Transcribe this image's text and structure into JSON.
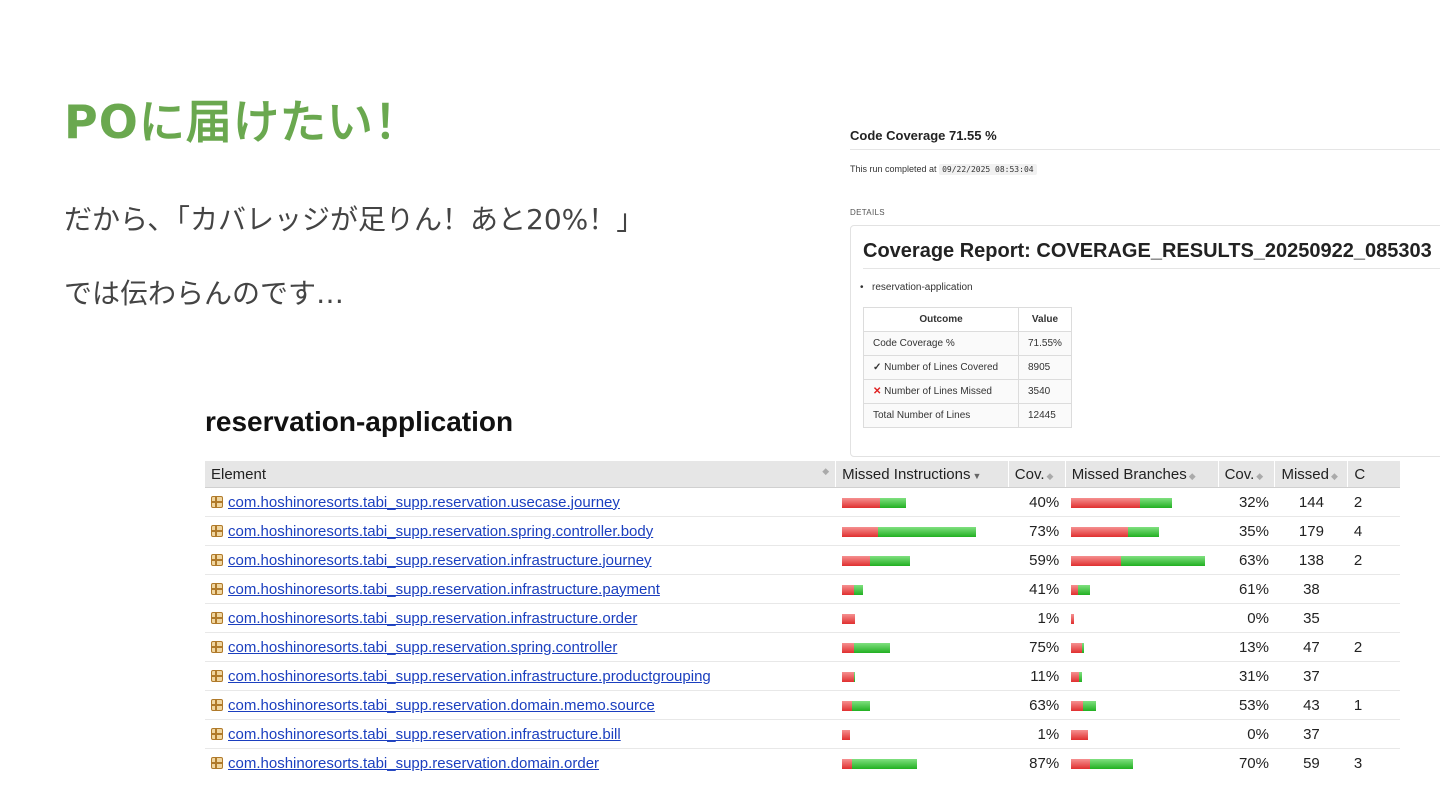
{
  "slide": {
    "title": "POに届けたい！",
    "line1": "だから､「カバレッジが足りん！あと20%！」",
    "line2": "では伝わらんのです…"
  },
  "coverage": {
    "title": "Code Coverage 71.55 %",
    "run_prefix": "This run completed at",
    "run_time": "09/22/2025 08:53:04",
    "details_label": "DETAILS",
    "report_title": "Coverage Report: COVERAGE_RESULTS_20250922_085303",
    "bullet": "reservation-application",
    "table_headers": [
      "Outcome",
      "Value"
    ],
    "rows": [
      {
        "icon": "",
        "label": "Code Coverage %",
        "value": "71.55%"
      },
      {
        "icon": "check-icon",
        "label": "Number of Lines Covered",
        "value": "8905"
      },
      {
        "icon": "cross-icon",
        "label": "Number of Lines Missed",
        "value": "3540"
      },
      {
        "icon": "",
        "label": "Total Number of Lines",
        "value": "12445"
      }
    ]
  },
  "report": {
    "title": "reservation-application",
    "headers": [
      "Element",
      "Missed Instructions",
      "Cov.",
      "Missed Branches",
      "Cov.",
      "Missed",
      "C"
    ],
    "colors": {
      "missed": "#e03030",
      "covered": "#22b022",
      "link": "#1b3fbf"
    },
    "rows": [
      {
        "element": "com.hoshinoresorts.tabi_supp.reservation.usecase.journey",
        "instr_total_rel": 0.48,
        "instr_cov": "40%",
        "instr_cov_frac": 0.4,
        "br_total_rel": 0.75,
        "br_cov": "32%",
        "br_cov_frac": 0.32,
        "missed": "144",
        "c": "2"
      },
      {
        "element": "com.hoshinoresorts.tabi_supp.reservation.spring.controller.body",
        "instr_total_rel": 1.0,
        "instr_cov": "73%",
        "instr_cov_frac": 0.73,
        "br_total_rel": 0.66,
        "br_cov": "35%",
        "br_cov_frac": 0.35,
        "missed": "179",
        "c": "4"
      },
      {
        "element": "com.hoshinoresorts.tabi_supp.reservation.infrastructure.journey",
        "instr_total_rel": 0.51,
        "instr_cov": "59%",
        "instr_cov_frac": 0.59,
        "br_total_rel": 1.0,
        "br_cov": "63%",
        "br_cov_frac": 0.63,
        "missed": "138",
        "c": "2"
      },
      {
        "element": "com.hoshinoresorts.tabi_supp.reservation.infrastructure.payment",
        "instr_total_rel": 0.16,
        "instr_cov": "41%",
        "instr_cov_frac": 0.41,
        "br_total_rel": 0.14,
        "br_cov": "61%",
        "br_cov_frac": 0.61,
        "missed": "38",
        "c": ""
      },
      {
        "element": "com.hoshinoresorts.tabi_supp.reservation.infrastructure.order",
        "instr_total_rel": 0.1,
        "instr_cov": "1%",
        "instr_cov_frac": 0.01,
        "br_total_rel": 0.02,
        "br_cov": "0%",
        "br_cov_frac": 0.0,
        "missed": "35",
        "c": ""
      },
      {
        "element": "com.hoshinoresorts.tabi_supp.reservation.spring.controller",
        "instr_total_rel": 0.36,
        "instr_cov": "75%",
        "instr_cov_frac": 0.75,
        "br_total_rel": 0.1,
        "br_cov": "13%",
        "br_cov_frac": 0.13,
        "missed": "47",
        "c": "2"
      },
      {
        "element": "com.hoshinoresorts.tabi_supp.reservation.infrastructure.productgrouping",
        "instr_total_rel": 0.1,
        "instr_cov": "11%",
        "instr_cov_frac": 0.11,
        "br_total_rel": 0.08,
        "br_cov": "31%",
        "br_cov_frac": 0.31,
        "missed": "37",
        "c": ""
      },
      {
        "element": "com.hoshinoresorts.tabi_supp.reservation.domain.memo.source",
        "instr_total_rel": 0.21,
        "instr_cov": "63%",
        "instr_cov_frac": 0.63,
        "br_total_rel": 0.19,
        "br_cov": "53%",
        "br_cov_frac": 0.53,
        "missed": "43",
        "c": "1"
      },
      {
        "element": "com.hoshinoresorts.tabi_supp.reservation.infrastructure.bill",
        "instr_total_rel": 0.06,
        "instr_cov": "1%",
        "instr_cov_frac": 0.01,
        "br_total_rel": 0.13,
        "br_cov": "0%",
        "br_cov_frac": 0.0,
        "missed": "37",
        "c": ""
      },
      {
        "element": "com.hoshinoresorts.tabi_supp.reservation.domain.order",
        "instr_total_rel": 0.56,
        "instr_cov": "87%",
        "instr_cov_frac": 0.87,
        "br_total_rel": 0.46,
        "br_cov": "70%",
        "br_cov_frac": 0.7,
        "missed": "59",
        "c": "3"
      }
    ]
  }
}
